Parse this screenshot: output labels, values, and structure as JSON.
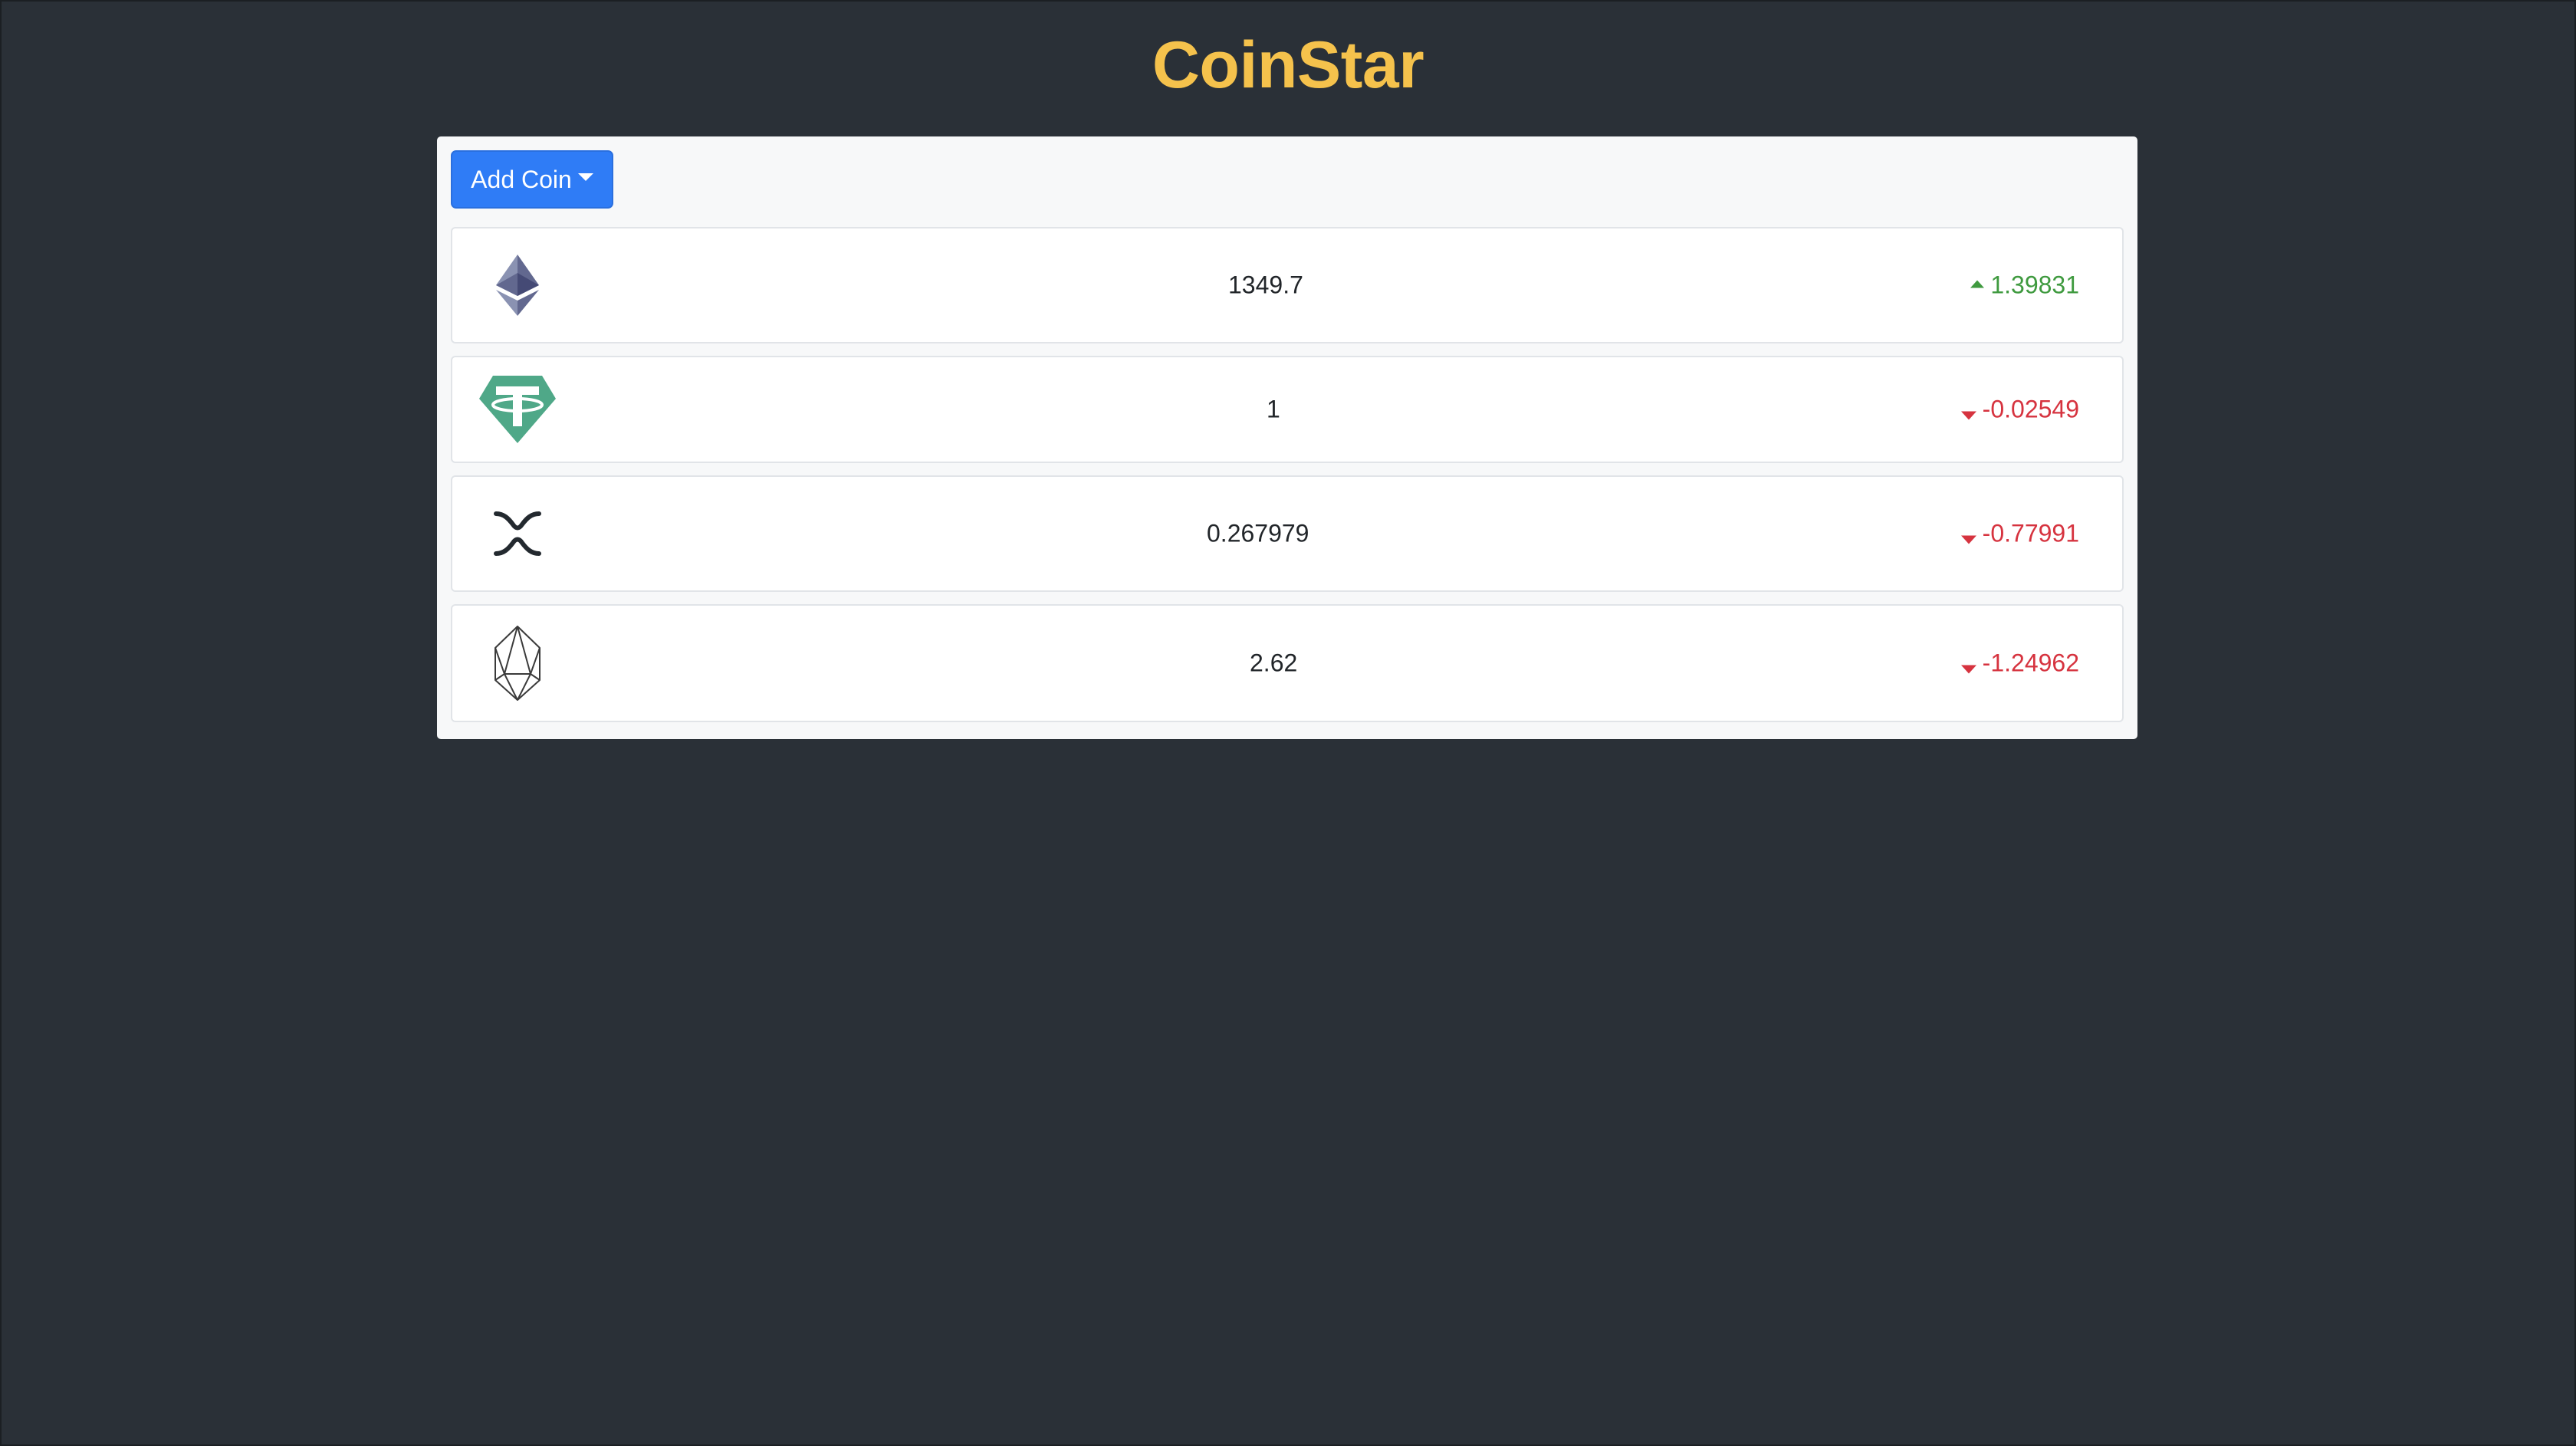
{
  "app": {
    "title": "CoinStar"
  },
  "toolbar": {
    "add_coin_label": "Add Coin"
  },
  "coins": [
    {
      "icon": "ethereum-icon",
      "price": "1349.7",
      "change": "1.39831",
      "direction": "up"
    },
    {
      "icon": "tether-icon",
      "price": "1",
      "change": "-0.02549",
      "direction": "down"
    },
    {
      "icon": "xrp-icon",
      "price": "0.267979",
      "change": "-0.77991",
      "direction": "down"
    },
    {
      "icon": "eos-icon",
      "price": "2.62",
      "change": "-1.24962",
      "direction": "down"
    }
  ],
  "colors": {
    "background": "#2a3037",
    "title": "#f5c24c",
    "button": "#2f7cf6",
    "positive": "#3f9a3f",
    "negative": "#d6333f"
  }
}
